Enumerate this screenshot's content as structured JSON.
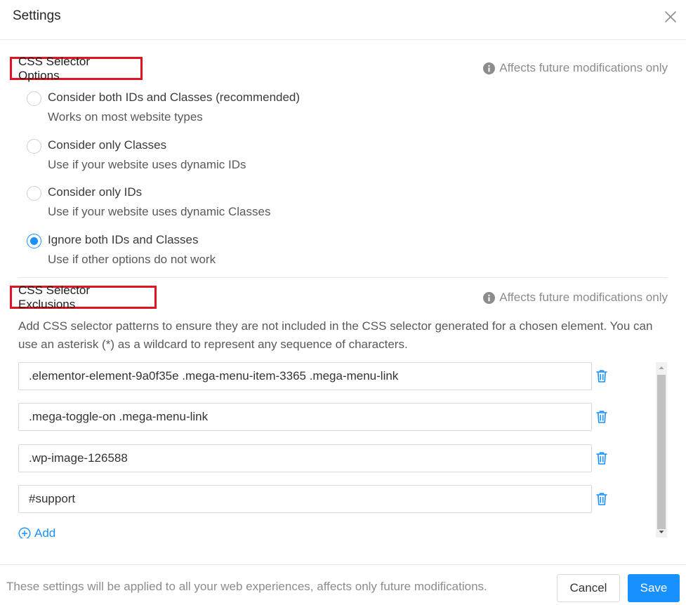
{
  "dialog": {
    "title": "Settings",
    "close_icon": "close-icon"
  },
  "selector_options": {
    "heading": "CSS Selector Options",
    "note": "Affects future modifications only",
    "note_icon": "info-icon",
    "selected_index": 3,
    "options": [
      {
        "label": "Consider both IDs and Classes (recommended)",
        "description": "Works on most website types",
        "checked": false
      },
      {
        "label": "Consider only Classes",
        "description": "Use if your website uses dynamic IDs",
        "checked": false
      },
      {
        "label": "Consider only IDs",
        "description": "Use if your website uses dynamic Classes",
        "checked": false
      },
      {
        "label": "Ignore both IDs and Classes",
        "description": "Use if other options do not work",
        "checked": true
      }
    ]
  },
  "selector_exclusions": {
    "heading": "CSS Selector Exclusions",
    "note": "Affects future modifications only",
    "note_icon": "info-icon",
    "description": "Add CSS selector patterns to ensure they are not included in the CSS selector generated for a chosen element. You can use an asterisk (*) as a wildcard to represent any sequence of characters.",
    "items": [
      {
        "value": ".elementor-element-9a0f35e .mega-menu-item-3365 .mega-menu-link"
      },
      {
        "value": ".mega-toggle-on .mega-menu-link"
      },
      {
        "value": ".wp-image-126588"
      },
      {
        "value": "#support"
      }
    ],
    "delete_icon": "trash-icon",
    "add_label": "Add",
    "add_icon": "plus-circle-icon"
  },
  "footer": {
    "text": "These settings will be applied to all your web experiences, affects only future modifications.",
    "cancel_label": "Cancel",
    "save_label": "Save"
  },
  "colors": {
    "accent": "#1890ff",
    "highlight_border": "#e0141e",
    "muted_text": "#8c8c8c",
    "border": "#d9d9d9"
  }
}
